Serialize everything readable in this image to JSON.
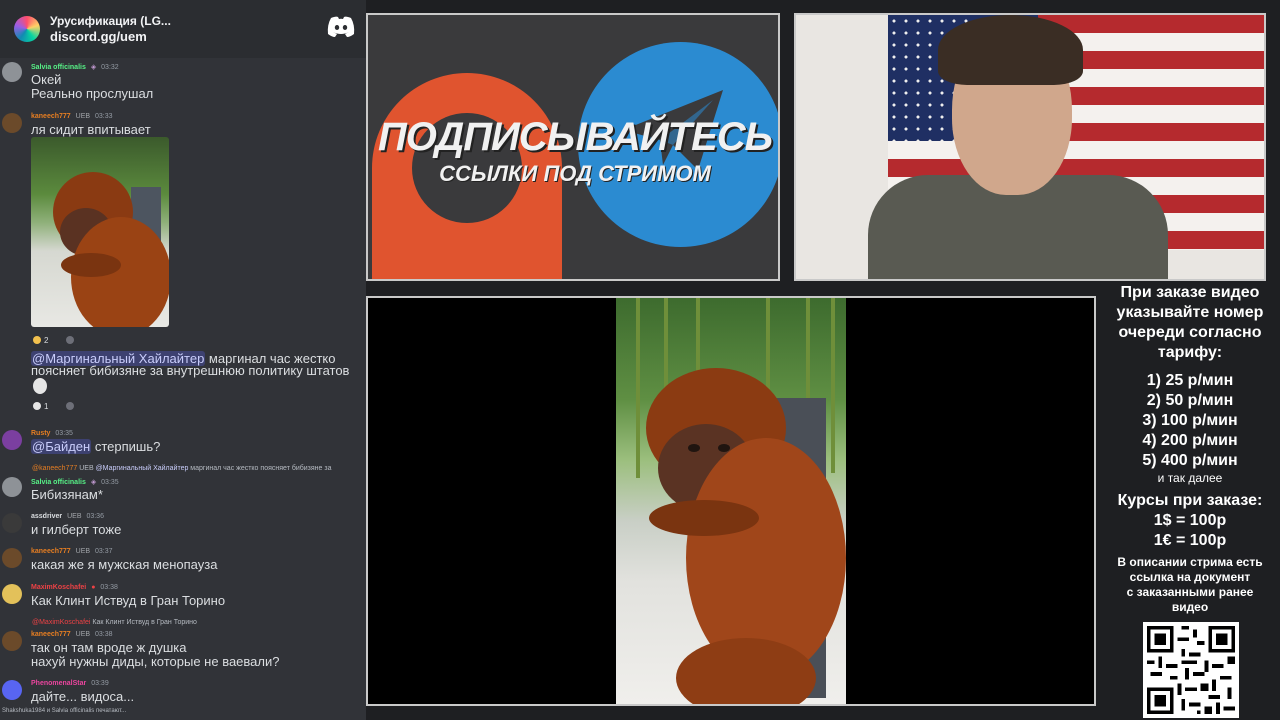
{
  "server": {
    "name": "Урусификация (LG...",
    "invite": "discord.gg/uem"
  },
  "messages": {
    "m1": {
      "user": "Salvia officinalis",
      "time": "03:32",
      "lines": [
        "Окей",
        "Реально прослушал"
      ]
    },
    "m2": {
      "user": "kaneech777",
      "tag": "UEB",
      "time": "03:33",
      "line": "ля сидит впитывает",
      "react_count": "2"
    },
    "m3": {
      "mention": "@Маргинальный Хайлайтер",
      "line1_rest": " маргинал час жестко",
      "line2": "поясняет бибизяне за внутрешнюю политику штатов",
      "react_count": "1"
    },
    "m4": {
      "user": "Rusty",
      "time": "03:35",
      "mention": "@Байден",
      "rest": " стерпишь?"
    },
    "m5": {
      "reply_user": "@kaneech777",
      "reply_tag": "UEB",
      "reply_mention": "@Маргинальный Хайлайтер",
      "reply_text": " маргинал час жестко поясняет бибизяне за",
      "user": "Salvia officinalis",
      "time": "03:35",
      "line": "Бибизянам*"
    },
    "m6": {
      "user": "assdriver",
      "tag": "UEB",
      "time": "03:36",
      "line": "и гилберт тоже"
    },
    "m7": {
      "user": "kaneech777",
      "tag": "UEB",
      "time": "03:37",
      "line": "какая же я мужская менопауза"
    },
    "m8": {
      "user": "MaximKoschafei",
      "time": "03:38",
      "line": "Как Клинт Иствуд в Гран Торино"
    },
    "m9": {
      "reply_user": "@MaximKoschafei",
      "reply_text": " Как Клинт Иствуд в Гран Торино",
      "user": "kaneech777",
      "tag": "UEB",
      "time": "03:38",
      "lines": [
        "так он там вроде ж душка",
        "нахуй нужны диды, которые не ваевали?"
      ]
    },
    "m10": {
      "user": "PhenomenalStar",
      "time": "03:39",
      "line": "дайте... видоса..."
    }
  },
  "typing": "Shakshuka1984 и Salvia officinalis печатают...",
  "promo": {
    "title": "ПОДПИСЫВАЙТЕСЬ",
    "subtitle": "ССЫЛКИ ПОД СТРИМОМ"
  },
  "info": {
    "heading": [
      "При заказе видео",
      "указывайте номер",
      "очереди согласно",
      "тарифу:"
    ],
    "tariffs": [
      "1) 25 р/мин",
      "2) 50 р/мин",
      "3) 100 р/мин",
      "4) 200 р/мин",
      "5) 400 р/мин"
    ],
    "etc": "и так далее",
    "rates_title": "Курсы при заказе:",
    "rates": [
      "1$ = 100р",
      "1€ = 100р"
    ],
    "note": [
      "В описании стрима есть",
      "ссылка на документ",
      "с заказанными ранее",
      "видео"
    ]
  },
  "colors": {
    "user_green": "#57f287",
    "user_orange": "#e67e22",
    "user_pink": "#eb459e",
    "user_blue": "#5865f2",
    "user_gray": "#dbdee1"
  },
  "icons": {
    "discord": "discord-logo-icon",
    "qr": "qr-code"
  }
}
